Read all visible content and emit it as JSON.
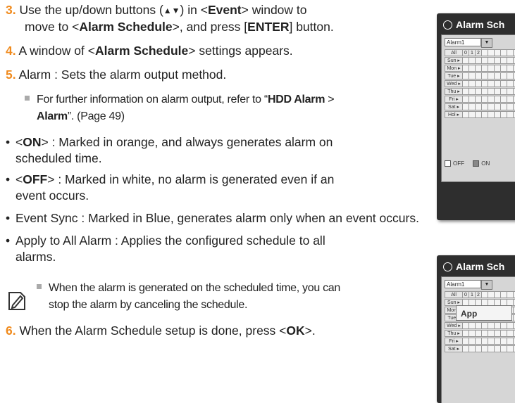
{
  "steps": [
    {
      "num": "3.",
      "pre": "Use the up/down buttons (",
      "arrows": "▲▼",
      "mid": ") in <",
      "b1": "Event",
      "mid2": "> window to"
    },
    {
      "line2a": "move to <",
      "b2": "Alarm Schedule",
      "line2b": ">, and press [",
      "b3": "ENTER",
      "line2c": "] button."
    },
    {
      "num": "4.",
      "pre": "A window of <",
      "b1": "Alarm Schedule",
      "post": "> settings appears."
    },
    {
      "num": "5.",
      "text": "Alarm : Sets the alarm output method."
    }
  ],
  "sub_note": {
    "pre": "For further information on alarm output, refer to “",
    "b1": "HDD Alarm",
    "mid": " >",
    "b2": "Alarm",
    "post": "”. (Page 49)"
  },
  "bullets": {
    "on": {
      "pre": "<",
      "b": "ON",
      "post": "> : Marked in orange, and always generates alarm on",
      "cont": "scheduled time."
    },
    "off": {
      "pre": "<",
      "b": "OFF",
      "post": "> : Marked in white, no alarm is generated even if an",
      "cont": "event occurs."
    },
    "sync": "Event Sync : Marked in Blue, generates alarm only when an event occurs.",
    "apply": {
      "l1": "Apply to All Alarm : Applies the configured schedule to all",
      "l2": "alarms."
    }
  },
  "note": {
    "l1": "When the alarm is generated on the scheduled time, you can",
    "l2": "stop the alarm by canceling the schedule."
  },
  "step6": {
    "num": "6.",
    "pre": "When the Alarm Schedule setup is done, press <",
    "b": "OK",
    "post": ">."
  },
  "screenshot1": {
    "title": "Alarm Sch",
    "select": "Alarm1",
    "all": "All",
    "hours": [
      "0",
      "1",
      "2"
    ],
    "days": [
      "Sun",
      "Mon",
      "Tue",
      "Wed",
      "Thu",
      "Fri",
      "Sat",
      "Hol"
    ],
    "legend_off": "OFF",
    "legend_on": "ON"
  },
  "screenshot2": {
    "title": "Alarm Sch",
    "select": "Alarm1",
    "all": "All",
    "hours": [
      "0",
      "1",
      "2"
    ],
    "days": [
      "Sun",
      "Mon",
      "Tue",
      "Wed",
      "Thu",
      "Fri",
      "Sat"
    ],
    "popup": "App"
  }
}
